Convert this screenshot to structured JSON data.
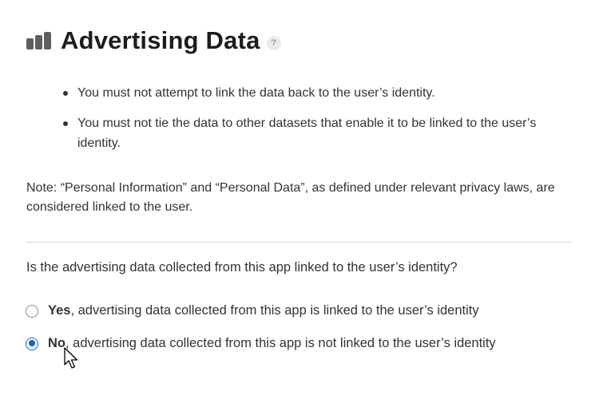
{
  "header": {
    "icon": "bar-chart-icon",
    "title": "Advertising Data",
    "help_label": "?"
  },
  "bullets": [
    "You must not attempt to link the data back to the user’s identity.",
    "You must not tie the data to other datasets that enable it to be linked to the user’s identity."
  ],
  "note": "Note: “Personal Information” and “Personal Data”, as defined under relevant privacy laws, are considered linked to the user.",
  "question": "Is the advertising data collected from this app linked to the user’s identity?",
  "options": [
    {
      "strong": "Yes",
      "rest": ", advertising data collected from this app is linked to the user’s identity",
      "selected": false
    },
    {
      "strong": "No",
      "rest": ", advertising data collected from this app is not linked to the user’s identity",
      "selected": true
    }
  ],
  "colors": {
    "accent": "#0a63d8",
    "text": "#333333",
    "title": "#1d1d1f",
    "divider": "#d9d9d9"
  }
}
